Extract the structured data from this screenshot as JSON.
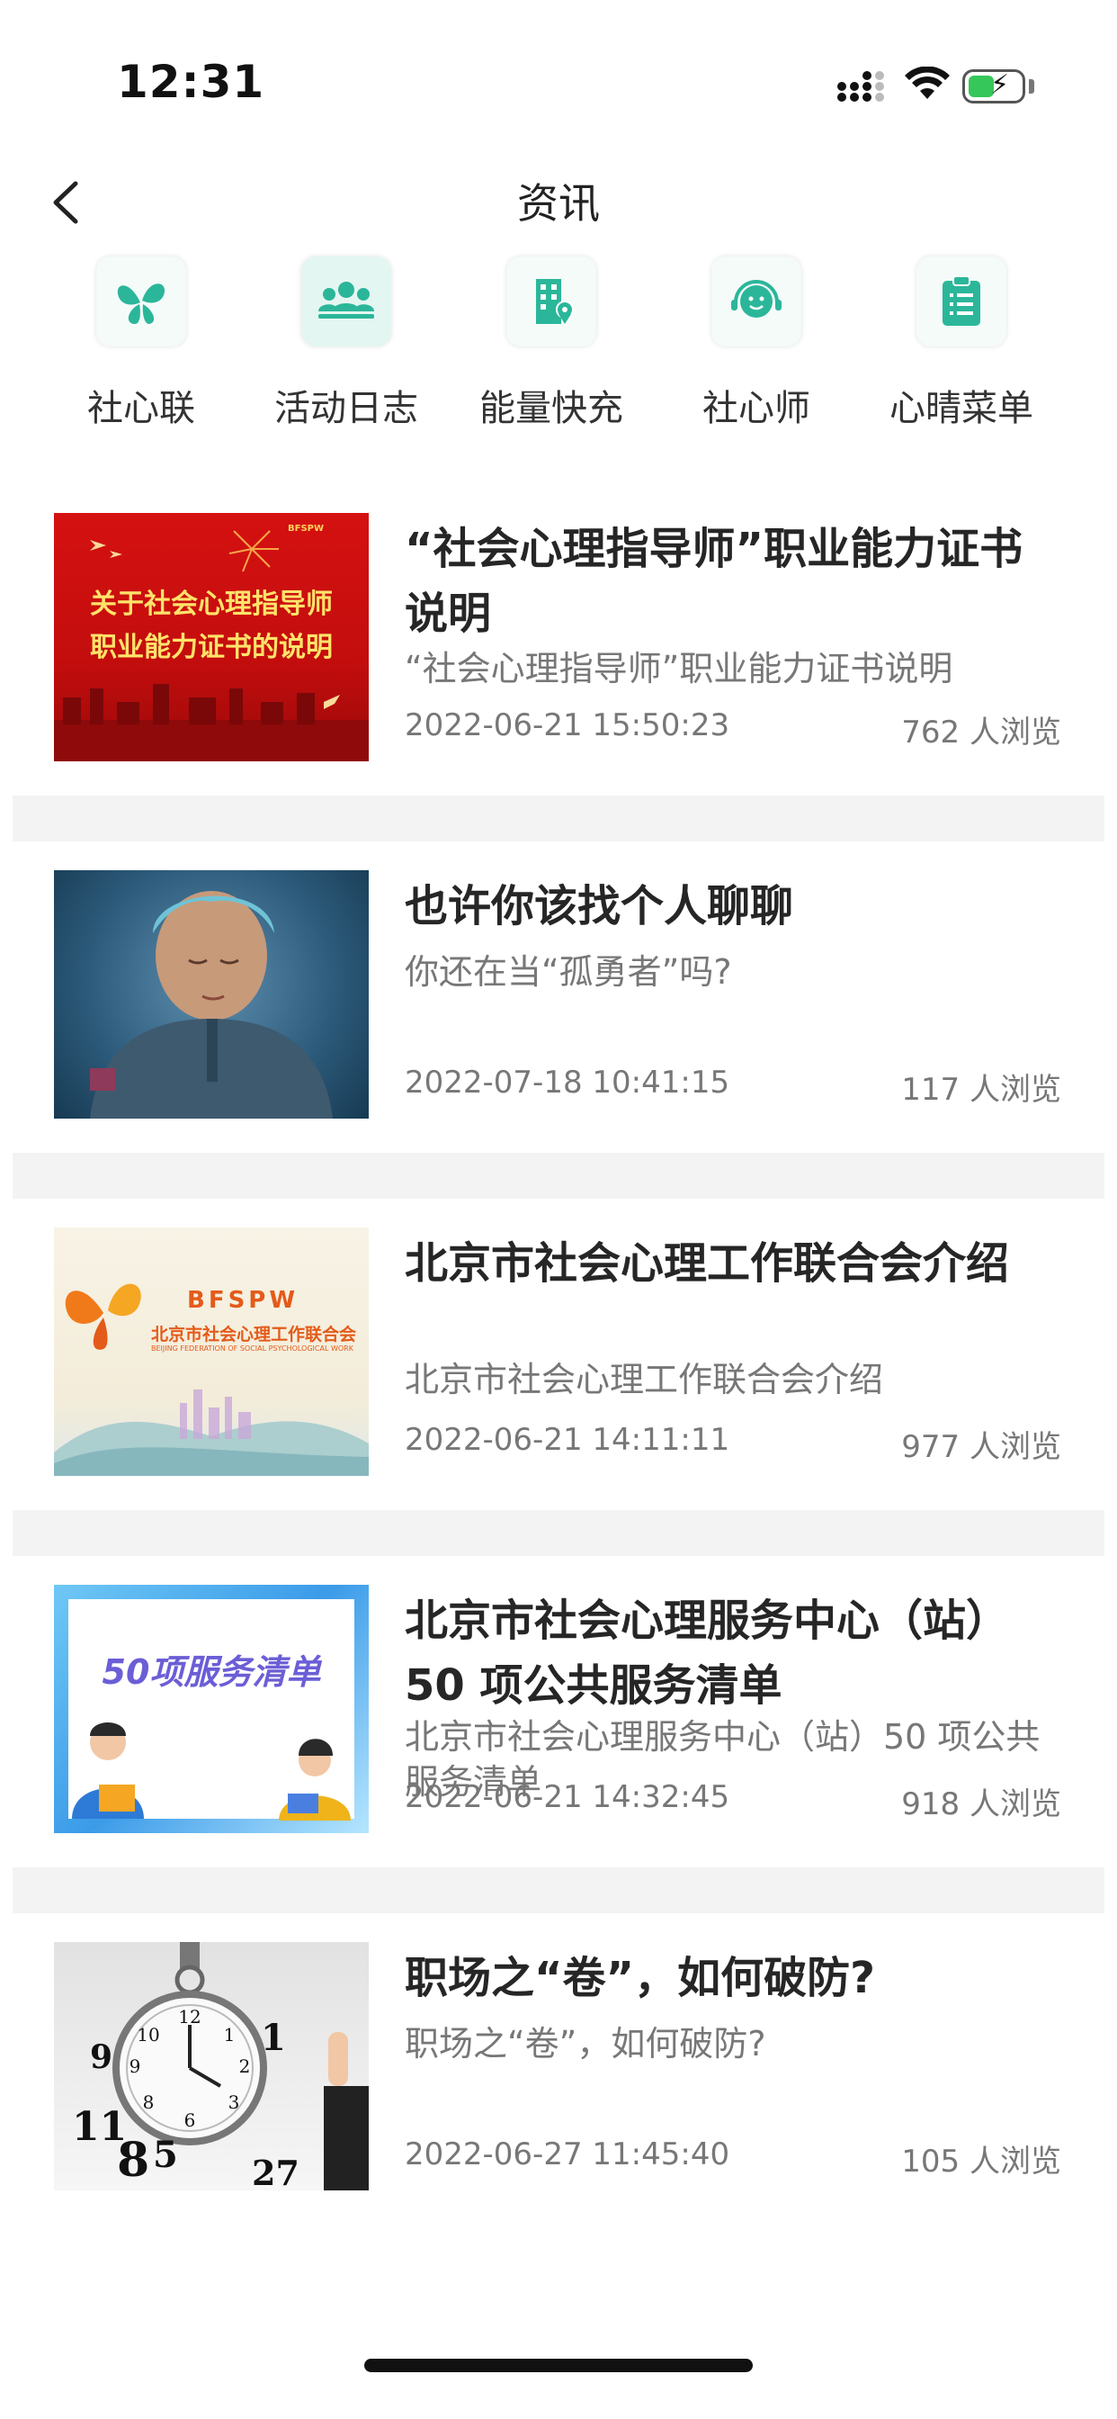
{
  "status_bar": {
    "time": "12:31"
  },
  "nav": {
    "title": "资讯"
  },
  "categories": [
    {
      "label": "社心联",
      "icon": "butterfly-icon"
    },
    {
      "label": "活动日志",
      "icon": "group-icon"
    },
    {
      "label": "能量快充",
      "icon": "building-pin-icon"
    },
    {
      "label": "社心师",
      "icon": "headset-person-icon"
    },
    {
      "label": "心晴菜单",
      "icon": "clipboard-list-icon"
    }
  ],
  "colors": {
    "accent": "#2bb69a",
    "separator": "#f3f3f3",
    "text_secondary": "#777777"
  },
  "news": [
    {
      "title": "“社会心理指导师”职业能力证书说明",
      "summary": "“社会心理指导师”职业能力证书说明",
      "date": "2022-06-21 15:50:23",
      "views": "762 人浏览",
      "thumb_text": [
        "关于社会心理指导师",
        "职业能力证书的说明"
      ]
    },
    {
      "title": "也许你该找个人聊聊",
      "summary": "你还在当“孤勇者”吗?",
      "date": "2022-07-18 10:41:15",
      "views": "117 人浏览"
    },
    {
      "title": "北京市社会心理工作联合会介绍",
      "summary": "北京市社会心理工作联合会介绍",
      "date": "2022-06-21 14:11:11",
      "views": "977 人浏览",
      "thumb_text": [
        "BFSPW",
        "北京市社会心理工作联合会",
        "BEIJING FEDERATION OF SOCIAL PSYCHOLOGICAL WORK"
      ]
    },
    {
      "title": "北京市社会心理服务中心（站）50 项公共服务清单",
      "summary": "北京市社会心理服务中心（站）50 项公共服务清单",
      "date": "2022-06-21 14:32:45",
      "views": "918 人浏览",
      "thumb_text": [
        "50项服务清单"
      ]
    },
    {
      "title": "职场之“卷”，如何破防?",
      "summary": "职场之“卷”，如何破防?",
      "date": "2022-06-27 11:45:40",
      "views": "105 人浏览"
    }
  ]
}
